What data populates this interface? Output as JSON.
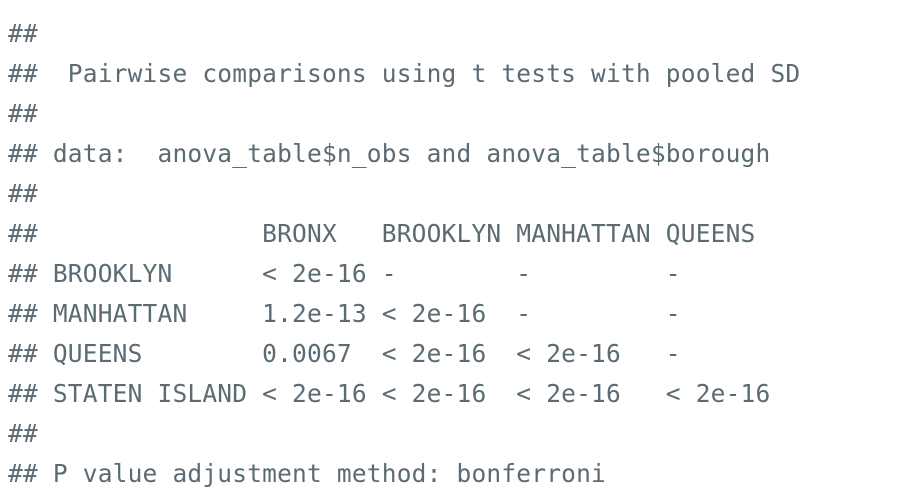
{
  "output": {
    "lines": [
      "##",
      "##  Pairwise comparisons using t tests with pooled SD",
      "##",
      "## data:  anova_table$n_obs and anova_table$borough",
      "##",
      "##               BRONX   BROOKLYN MANHATTAN QUEENS",
      "## BROOKLYN      < 2e-16 -        -         -",
      "## MANHATTAN     1.2e-13 < 2e-16  -         -",
      "## QUEENS        0.0067  < 2e-16  < 2e-16   -",
      "## STATEN ISLAND < 2e-16 < 2e-16  < 2e-16   < 2e-16",
      "##",
      "## P value adjustment method: bonferroni"
    ]
  }
}
